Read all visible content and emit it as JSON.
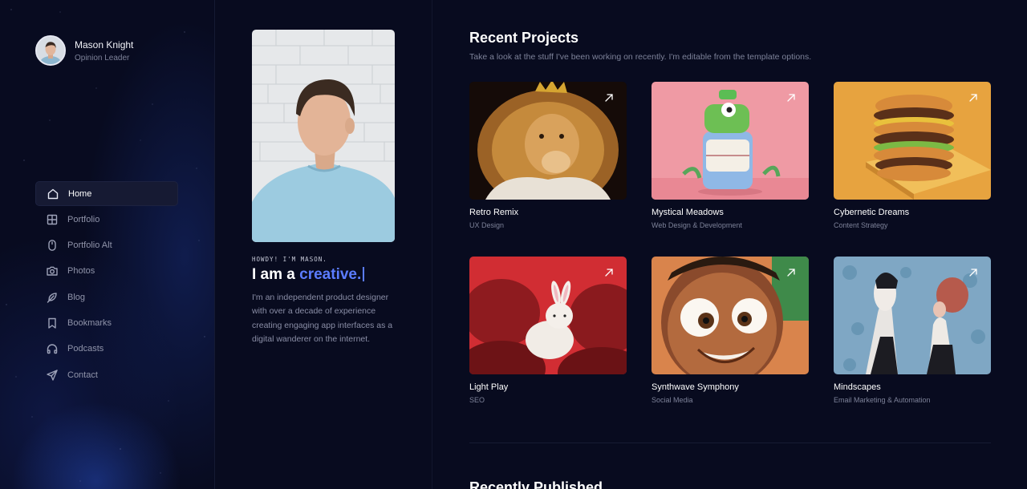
{
  "profile": {
    "name": "Mason Knight",
    "role": "Opinion Leader"
  },
  "nav": [
    {
      "label": "Home",
      "icon": "home-icon",
      "active": true
    },
    {
      "label": "Portfolio",
      "icon": "grid-icon"
    },
    {
      "label": "Portfolio Alt",
      "icon": "mouse-icon"
    },
    {
      "label": "Photos",
      "icon": "camera-icon"
    },
    {
      "label": "Blog",
      "icon": "feather-icon"
    },
    {
      "label": "Bookmarks",
      "icon": "bookmark-icon"
    },
    {
      "label": "Podcasts",
      "icon": "headphones-icon"
    },
    {
      "label": "Contact",
      "icon": "send-icon"
    }
  ],
  "intro": {
    "eyebrow": "HOWDY! I'M MASON.",
    "headline_prefix": "I am a",
    "headline_accent": "creative.",
    "bio": "I'm an independent product designer with over a decade of experience creating engaging app interfaces as a digital wanderer on the internet."
  },
  "projects": {
    "title": "Recent Projects",
    "subtitle": "Take a look at the stuff I've been working on recently. I'm editable from the template options.",
    "items": [
      {
        "title": "Retro Remix",
        "category": "UX Design"
      },
      {
        "title": "Mystical Meadows",
        "category": "Web Design & Development"
      },
      {
        "title": "Cybernetic Dreams",
        "category": "Content Strategy"
      },
      {
        "title": "Light Play",
        "category": "SEO"
      },
      {
        "title": "Synthwave Symphony",
        "category": "Social Media"
      },
      {
        "title": "Mindscapes",
        "category": "Email Marketing & Automation"
      }
    ]
  },
  "published": {
    "title": "Recently Published"
  },
  "colors": {
    "background": "#080b1f",
    "accent": "#5b7cff",
    "muted": "#7d8299"
  }
}
